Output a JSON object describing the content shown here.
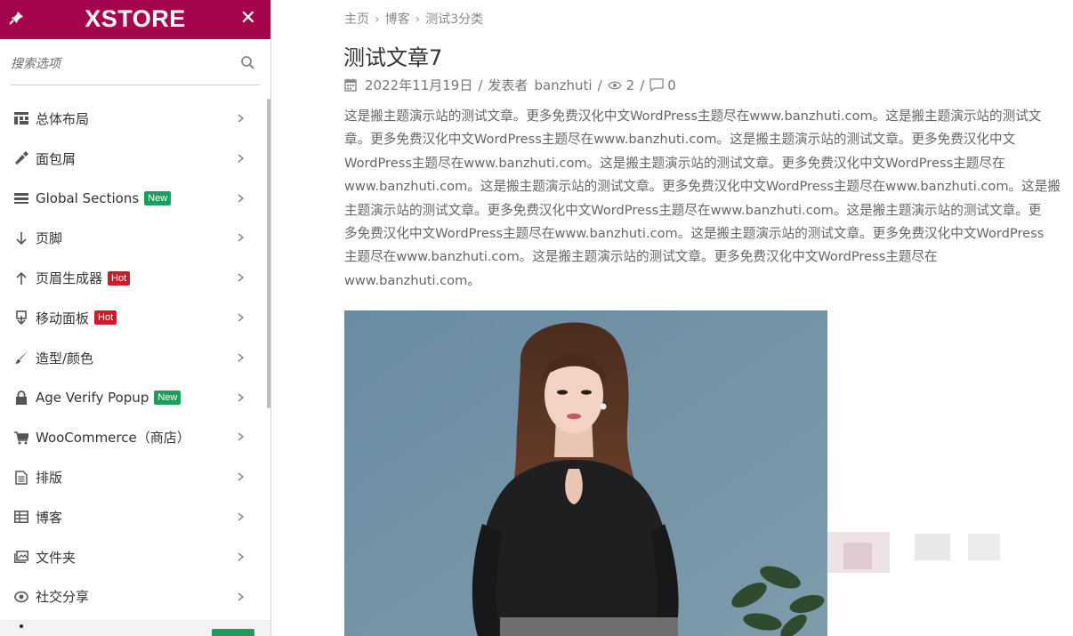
{
  "sidebar": {
    "brand": "XSTORE",
    "search_placeholder": "搜索选项",
    "items": [
      {
        "label": "总体布局",
        "icon": "layout-icon"
      },
      {
        "label": "面包屑",
        "icon": "brush-icon"
      },
      {
        "label": "Global Sections",
        "badge": "New",
        "icon": "sections-icon"
      },
      {
        "label": "页脚",
        "icon": "arrow-down-icon"
      },
      {
        "label": "页眉生成器",
        "badge": "Hot",
        "icon": "arrow-up-icon"
      },
      {
        "label": "移动面板",
        "badge": "Hot",
        "icon": "mobile-panel-icon"
      },
      {
        "label": "造型/颜色",
        "icon": "paintbrush-icon"
      },
      {
        "label": "Age Verify Popup",
        "badge": "New",
        "icon": "lock-icon"
      },
      {
        "label": "WooCommerce（商店）",
        "icon": "cart-icon"
      },
      {
        "label": "排版",
        "icon": "document-icon"
      },
      {
        "label": "博客",
        "icon": "grid-icon"
      },
      {
        "label": "文件夹",
        "icon": "gallery-icon"
      },
      {
        "label": "社交分享",
        "icon": "share-icon"
      }
    ]
  },
  "main": {
    "breadcrumb": [
      "主页",
      "博客",
      "测试3分类"
    ],
    "title": "测试文章7",
    "meta": {
      "date": "2022年11月19日",
      "author_prefix": "发表者",
      "author": "banzhuti",
      "views": "2",
      "comments": "0"
    },
    "body_lines": [
      "这是搬主题演示站的测试文章。更多免费汉化中文WordPress主题尽在www.banzhuti.com。这是搬主题演示站的测试文",
      "章。更多免费汉化中文WordPress主题尽在www.banzhuti.com。这是搬主题演示站的测试文章。更多免费汉化中文",
      "WordPress主题尽在www.banzhuti.com。这是搬主题演示站的测试文章。更多免费汉化中文WordPress主题尽在",
      "www.banzhuti.com。这是搬主题演示站的测试文章。更多免费汉化中文WordPress主题尽在www.banzhuti.com。这是搬",
      "主题演示站的测试文章。更多免费汉化中文WordPress主题尽在www.banzhuti.com。这是搬主题演示站的测试文章。更",
      "多免费汉化中文WordPress主题尽在www.banzhuti.com。这是搬主题演示站的测试文章。更多免费汉化中文WordPress",
      "主题尽在www.banzhuti.com。这是搬主题演示站的测试文章。更多免费汉化中文WordPress主题尽在",
      "www.banzhuti.com。"
    ]
  },
  "colors": {
    "brand": "#a5054c",
    "new_badge": "#1c9e5a",
    "hot_badge": "#c61f2b"
  }
}
